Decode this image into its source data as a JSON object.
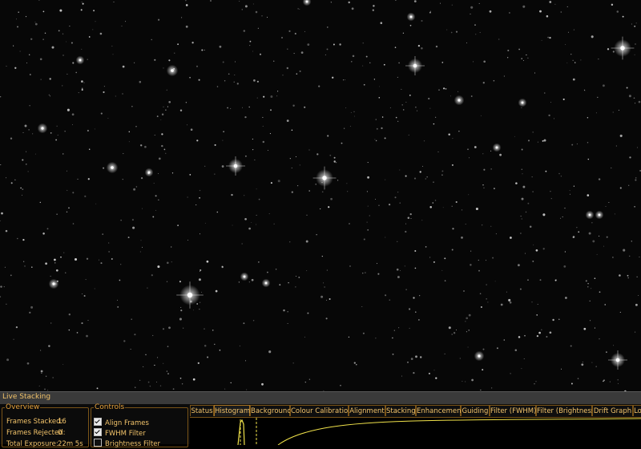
{
  "panel": {
    "title": "Live Stacking"
  },
  "overview": {
    "legend": "Overview",
    "rows": [
      {
        "label": "Frames Stacked:",
        "value": "16"
      },
      {
        "label": "Frames Rejected:",
        "value": "0"
      },
      {
        "label": "Total Exposure:",
        "value": "22m 5s"
      }
    ]
  },
  "controls": {
    "legend": "Controls",
    "items": [
      {
        "label": "Align Frames",
        "checked": true
      },
      {
        "label": "FWHM Filter",
        "checked": true
      },
      {
        "label": "Brightness Filter",
        "checked": false
      }
    ]
  },
  "tabs": [
    "Status",
    "Histogram",
    "Background",
    "Colour Calibration",
    "Alignment",
    "Stacking",
    "Enhancement",
    "Guiding",
    "Filter (FWHM)",
    "Filter (Brightness)",
    "Drift Graph",
    "Lo"
  ],
  "active_tab": "Histogram",
  "colors": {
    "accent": "#f2c36a",
    "border": "#7a5418",
    "histogram_curve": "#f0e24a"
  }
}
